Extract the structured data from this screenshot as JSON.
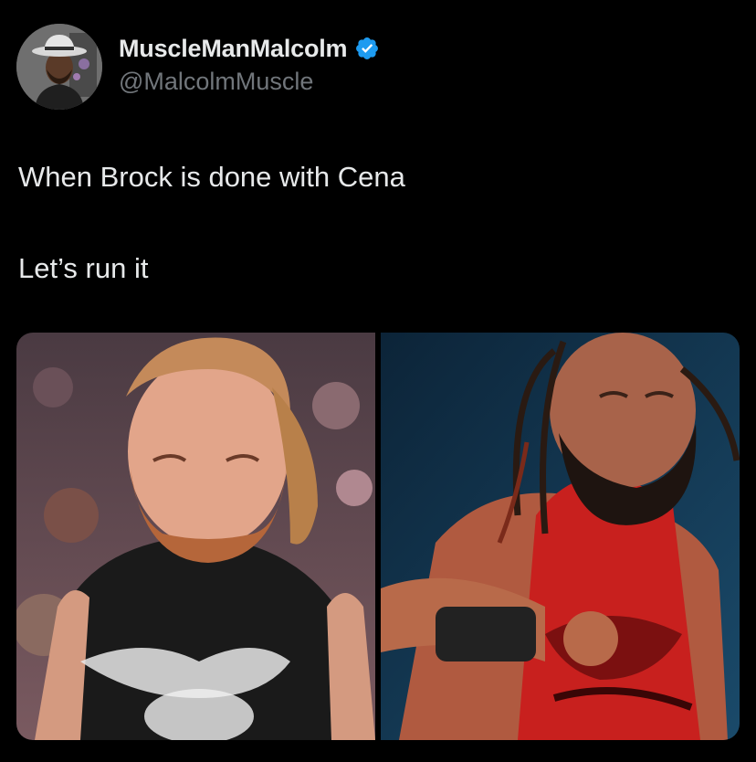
{
  "tweet": {
    "author": {
      "display_name": "MuscleManMalcolm",
      "handle": "@MalcolmMuscle",
      "verified": true,
      "avatar_icon": "profile-photo-man-in-hat"
    },
    "text_lines": [
      "When Brock is done with Cena",
      "Let’s run it"
    ],
    "media": [
      {
        "description_icon": "wrestler-photo-bearded-man-black-shirt"
      },
      {
        "description_icon": "wrestler-photo-bearded-man-red-singlet"
      }
    ],
    "colors": {
      "background": "#000000",
      "text": "#e7e9ea",
      "secondary_text": "#71767b",
      "verified_badge": "#1d9bf0"
    }
  }
}
